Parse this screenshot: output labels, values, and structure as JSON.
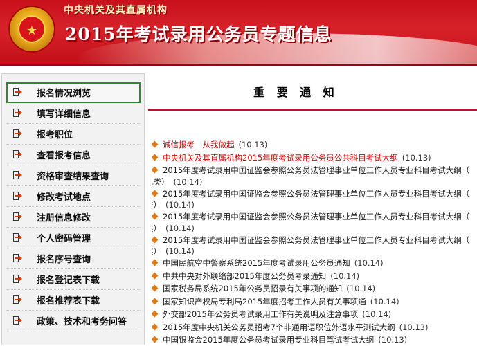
{
  "banner": {
    "subtitle": "中央机关及其直属机构",
    "title": "2015年考试录用公务员专题信息"
  },
  "sidebar": {
    "items": [
      {
        "label": "报名情况浏览",
        "active": true
      },
      {
        "label": "填写详细信息"
      },
      {
        "label": "报考职位"
      },
      {
        "label": "查看报考信息"
      },
      {
        "label": "资格审查结果查询"
      },
      {
        "label": "修改考试地点"
      },
      {
        "label": "注册信息修改"
      },
      {
        "label": "个人密码管理"
      },
      {
        "label": "报名序号查询"
      },
      {
        "label": "报名登记表下载"
      },
      {
        "label": "报名推荐表下载"
      },
      {
        "label": "政策、技术和考务问答"
      }
    ]
  },
  "main": {
    "title": "重 要 通 知",
    "notices": [
      {
        "text": "诚信报考　从我做起",
        "date": "(10.13)",
        "red": true
      },
      {
        "text": "中央机关及其直属机构2015年度考试录用公务员公共科目考试大纲",
        "date": "(10.13)",
        "red": true
      },
      {
        "text": "2015年度考试录用中国证监会参照公务员法管理事业单位工作人员专业科目考试大纲（",
        "cont": "机类）",
        "date": "(10.14)"
      },
      {
        "text": "2015年度考试录用中国证监会参照公务员法管理事业单位工作人员专业科目考试大纲（",
        "cont": "类）",
        "date": "(10.14)"
      },
      {
        "text": "2015年度考试录用中国证监会参照公务员法管理事业单位工作人员专业科目考试大纲（",
        "cont": "类）",
        "date": "(10.14)"
      },
      {
        "text": "2015年度考试录用中国证监会参照公务员法管理事业单位工作人员专业科目考试大纲（",
        "cont": "类）",
        "date": "(10.14)"
      },
      {
        "text": "中国民航空中警察系统2015年度考试录用公务员通知",
        "date": "(10.14)"
      },
      {
        "text": "中共中央对外联络部2015年度公务员考录通知",
        "date": "(10.14)"
      },
      {
        "text": "国家税务局系统2015年公务员招录有关事项的通知",
        "date": "(10.14)"
      },
      {
        "text": "国家知识产权局专利局2015年度招考工作人员有关事项通",
        "date": "(10.14)"
      },
      {
        "text": "外交部2015年公务员考试录用工作有关说明及注意事项",
        "date": "(10.14)"
      },
      {
        "text": "2015年度中央机关公务员招考7个非通用语职位外语水平测试大纲",
        "date": "(10.13)"
      },
      {
        "text": "中国银监会2015年度公务员考试录用专业科目笔试考试大纲",
        "date": "(10.13)"
      }
    ]
  },
  "colors": {
    "banner_red": "#c7101a",
    "notice_red": "#d40000",
    "diamond": "#e07a14",
    "active_outline": "#2b8a2b"
  }
}
